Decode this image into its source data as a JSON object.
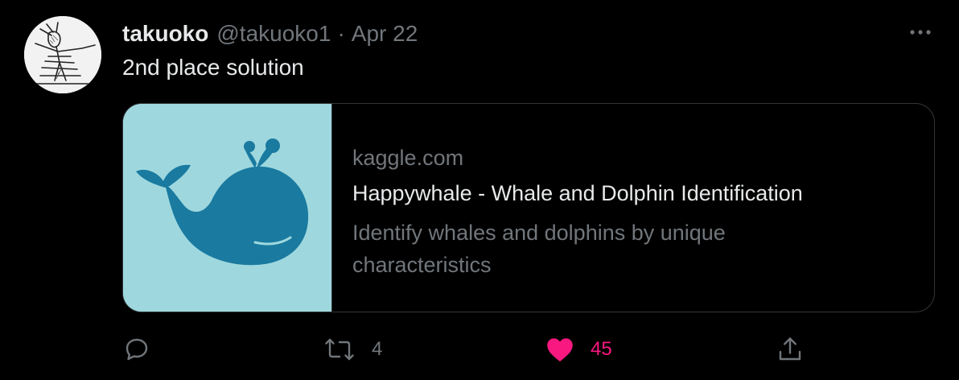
{
  "tweet": {
    "author_name": "takuoko",
    "author_handle": "@takuoko1",
    "separator": "·",
    "date": "Apr 22",
    "text": "2nd place solution"
  },
  "card": {
    "domain": "kaggle.com",
    "title": "Happywhale - Whale and Dolphin Identification",
    "description": "Identify whales and dolphins by unique characteristics",
    "image_icon": "whale-icon",
    "image_bg": "#9ed8de",
    "whale_color": "#1a7aa0"
  },
  "actions": {
    "reply_icon": "reply-icon",
    "retweet_icon": "retweet-icon",
    "retweet_count": "4",
    "like_icon": "heart-icon",
    "like_count": "45",
    "like_color": "#f91880",
    "share_icon": "share-icon"
  },
  "more_icon": "more-icon"
}
